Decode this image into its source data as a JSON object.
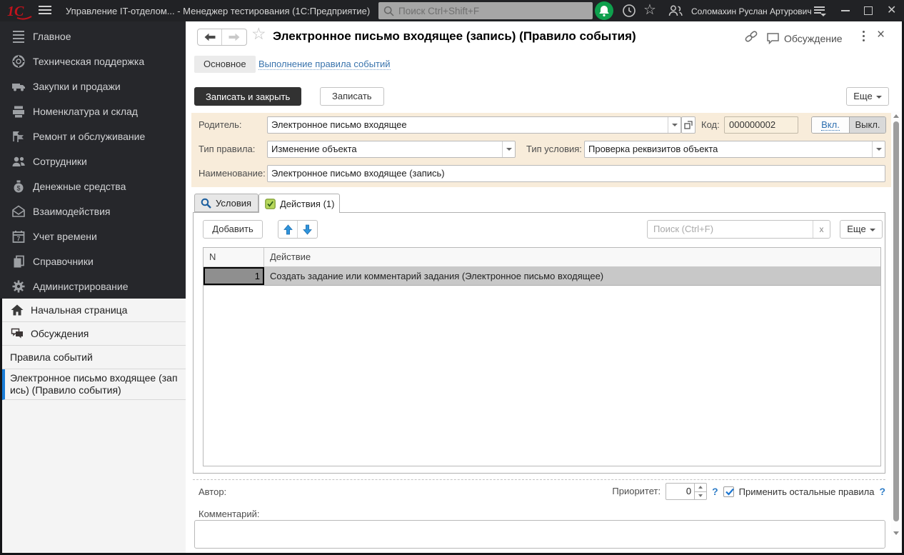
{
  "titlebar": {
    "logo": "1С",
    "app_title": "Управление IT-отделом...  - Менеджер тестирования (1С:Предприятие)",
    "search_placeholder": "Поиск Ctrl+Shift+F",
    "user_name": "Соломахин Руслан Артурович",
    "star": "☆"
  },
  "sidebar": {
    "items": [
      {
        "label": "Главное"
      },
      {
        "label": "Техническая поддержка"
      },
      {
        "label": "Закупки и продажи"
      },
      {
        "label": "Номенклатура и склад"
      },
      {
        "label": "Ремонт и обслуживание"
      },
      {
        "label": "Сотрудники"
      },
      {
        "label": "Денежные средства"
      },
      {
        "label": "Взаимодействия"
      },
      {
        "label": "Учет времени"
      },
      {
        "label": "Справочники"
      },
      {
        "label": "Администрирование"
      }
    ],
    "taskbar": [
      {
        "label": "Начальная страница"
      },
      {
        "label": "Обсуждения"
      },
      {
        "label": "Правила событий"
      },
      {
        "label": "Электронное письмо входящее (запись) (Правило события)"
      }
    ]
  },
  "content": {
    "star": "☆",
    "title": "Электронное письмо входящее (запись) (Правило события)",
    "discussion_label": "Обсуждение",
    "close": "×",
    "nav_main": "Основное",
    "nav_link": "Выполнение правила событий",
    "save_close": "Записать и закрыть",
    "save": "Записать",
    "more": "Еще",
    "form": {
      "parent_label": "Родитель:",
      "parent_value": "Электронное письмо входящее",
      "code_label": "Код:",
      "code_value": "000000002",
      "on_label": "Вкл.",
      "off_label": "Выкл.",
      "rule_type_label": "Тип правила:",
      "rule_type_value": "Изменение объекта",
      "condition_type_label": "Тип условия:",
      "condition_type_value": "Проверка реквизитов объекта",
      "name_label": "Наименование:",
      "name_value": "Электронное письмо входящее (запись)"
    },
    "tabs": {
      "conditions": "Условия",
      "actions": "Действия (1)"
    },
    "toolbar": {
      "add": "Добавить",
      "search_placeholder": "Поиск (Ctrl+F)",
      "clear": "x",
      "more": "Еще"
    },
    "table": {
      "col_n": "N",
      "col_action": "Действие",
      "rows": [
        {
          "n": "1",
          "action": "Создать задание или комментарий задания (Электронное письмо входящее)"
        }
      ]
    },
    "footer": {
      "author_label": "Автор:",
      "priority_label": "Приоритет:",
      "priority_value": "0",
      "help": "?",
      "apply_other_label": "Применить остальные правила",
      "comment_label": "Комментарий:"
    }
  }
}
